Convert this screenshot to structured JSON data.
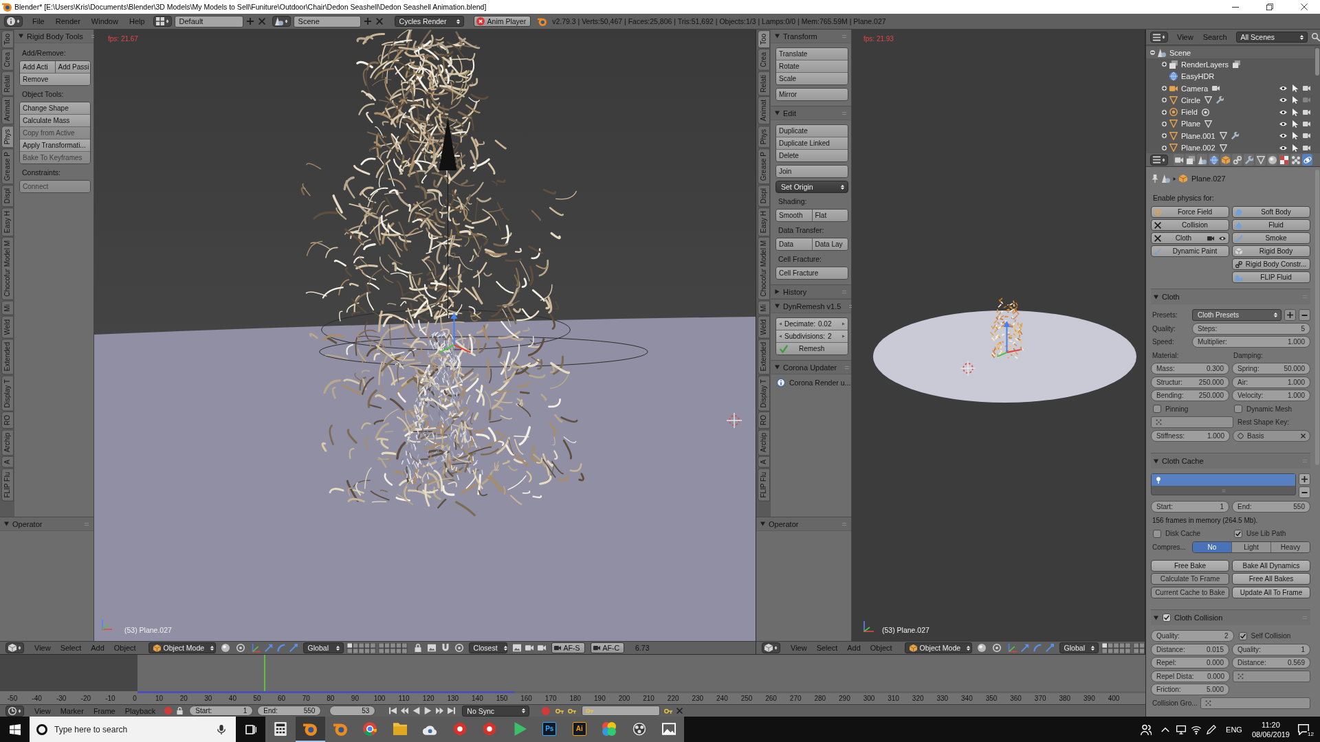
{
  "window": {
    "title": "Blender* [E:\\Users\\Kris\\Documents\\Blender\\3D Models\\My Models to Sell\\Funiture\\Outdoor\\Chair\\Dedon Seashell\\Dedon Seashell Animation.blend]"
  },
  "info_header": {
    "menus": [
      "File",
      "Render",
      "Window",
      "Help"
    ],
    "screen_layout": "Default",
    "scene": "Scene",
    "render_engine": "Cycles Render",
    "anim_player": "Anim Player",
    "stats": "v2.79.3 | Verts:50,467 | Faces:25,806 | Tris:51,692 | Objects:1/3 | Lamps:0/0 | Mem:765.59M | Plane.027"
  },
  "views": [
    {
      "tabs": [
        {
          "label": "Too",
          "selected": false
        },
        {
          "label": "Crea",
          "selected": false
        },
        {
          "label": "Relati",
          "selected": false
        },
        {
          "label": "Animat",
          "selected": false
        },
        {
          "label": "Phys",
          "selected": true
        },
        {
          "label": "Grease P",
          "selected": false
        },
        {
          "label": "Displ",
          "selected": false
        },
        {
          "label": "Easy H",
          "selected": false
        },
        {
          "label": "Chocofur Model M",
          "selected": false
        },
        {
          "label": "Mi",
          "selected": false
        },
        {
          "label": "Weld",
          "selected": false
        },
        {
          "label": "Extended",
          "selected": false
        },
        {
          "label": "Display T",
          "selected": false
        },
        {
          "label": "RO",
          "selected": false
        },
        {
          "label": "Archip",
          "selected": false
        },
        {
          "label": "A",
          "selected": false
        },
        {
          "label": "FLIP Flu",
          "selected": false
        }
      ],
      "panels": [
        {
          "title": "Rigid Body Tools",
          "expanded": true,
          "items": [
            {
              "kind": "label",
              "text": "Add/Remove:"
            },
            {
              "kind": "block",
              "rows": [
                [
                  {
                    "label": "Add Acti",
                    "disabled": false
                  },
                  {
                    "label": "Add Passi",
                    "disabled": false
                  }
                ],
                [
                  {
                    "label": "Remove",
                    "disabled": false
                  }
                ]
              ]
            },
            {
              "kind": "label",
              "text": "Object Tools:"
            },
            {
              "kind": "block",
              "rows": [
                [
                  {
                    "label": "Change Shape",
                    "disabled": false
                  }
                ],
                [
                  {
                    "label": "Calculate Mass",
                    "disabled": false
                  }
                ],
                [
                  {
                    "label": "Copy from Active",
                    "disabled": true
                  }
                ],
                [
                  {
                    "label": "Apply Transformati...",
                    "disabled": false
                  }
                ],
                [
                  {
                    "label": "Bake To Keyframes",
                    "disabled": true
                  }
                ]
              ]
            },
            {
              "kind": "label",
              "text": "Constraints:"
            },
            {
              "kind": "block",
              "rows": [
                [
                  {
                    "label": "Connect",
                    "disabled": true
                  }
                ]
              ]
            }
          ]
        }
      ],
      "operator": {
        "title": "Operator",
        "expanded": true
      },
      "viewport": {
        "kind": "closeup",
        "fps": "fps: 21.67",
        "object_label": "(53) Plane.027"
      },
      "header": {
        "menus": [
          "View",
          "Select",
          "Add",
          "Object"
        ],
        "mode": "Object Mode",
        "orientation": "Global",
        "snap_target": "Closest",
        "toggles": [
          "AF-S",
          "AF-C"
        ],
        "readout": "6.73"
      }
    },
    {
      "tabs": [
        {
          "label": "Too",
          "selected": true
        },
        {
          "label": "Crea",
          "selected": false
        },
        {
          "label": "Relati",
          "selected": false
        },
        {
          "label": "Animat",
          "selected": false
        },
        {
          "label": "Phys",
          "selected": false
        },
        {
          "label": "Grease P",
          "selected": false
        },
        {
          "label": "Displ",
          "selected": false
        },
        {
          "label": "Easy H",
          "selected": false
        },
        {
          "label": "Chocofur Model M",
          "selected": false
        },
        {
          "label": "Mi",
          "selected": false
        },
        {
          "label": "Weld",
          "selected": false
        },
        {
          "label": "Extended",
          "selected": false
        },
        {
          "label": "Display T",
          "selected": false
        },
        {
          "label": "RO",
          "selected": false
        },
        {
          "label": "Archip",
          "selected": false
        },
        {
          "label": "A",
          "selected": false
        },
        {
          "label": "FLIP Flu",
          "selected": false
        }
      ],
      "panels": [
        {
          "title": "Transform",
          "expanded": true,
          "items": [
            {
              "kind": "block",
              "rows": [
                [
                  {
                    "label": "Translate"
                  }
                ],
                [
                  {
                    "label": "Rotate"
                  }
                ],
                [
                  {
                    "label": "Scale"
                  }
                ]
              ]
            },
            {
              "kind": "block",
              "rows": [
                [
                  {
                    "label": "Mirror"
                  }
                ]
              ]
            }
          ]
        },
        {
          "title": "Edit",
          "expanded": true,
          "items": [
            {
              "kind": "block",
              "rows": [
                [
                  {
                    "label": "Duplicate"
                  }
                ],
                [
                  {
                    "label": "Duplicate Linked"
                  }
                ],
                [
                  {
                    "label": "Delete"
                  }
                ]
              ]
            },
            {
              "kind": "block",
              "rows": [
                [
                  {
                    "label": "Join"
                  }
                ]
              ]
            },
            {
              "kind": "dropdown",
              "label": "Set Origin"
            },
            {
              "kind": "label",
              "text": "Shading:"
            },
            {
              "kind": "block",
              "rows": [
                [
                  {
                    "label": "Smooth"
                  },
                  {
                    "label": "Flat"
                  }
                ]
              ]
            },
            {
              "kind": "label",
              "text": "Data Transfer:"
            },
            {
              "kind": "block",
              "rows": [
                [
                  {
                    "label": "Data"
                  },
                  {
                    "label": "Data Lay"
                  }
                ]
              ]
            },
            {
              "kind": "label",
              "text": "Cell Fracture:"
            },
            {
              "kind": "block",
              "rows": [
                [
                  {
                    "label": "Cell Fracture"
                  }
                ]
              ]
            }
          ]
        },
        {
          "title": "History",
          "expanded": false
        },
        {
          "title": "DynRemesh v1.5",
          "expanded": true,
          "items": [
            {
              "kind": "block",
              "rows": [
                [
                  {
                    "kind": "number",
                    "label": "Decimate:",
                    "value": "0.02"
                  }
                ],
                [
                  {
                    "kind": "number",
                    "label": "Subdivisions:",
                    "value": "2"
                  }
                ],
                [
                  {
                    "kind": "check_button",
                    "label": "Remesh"
                  }
                ]
              ]
            }
          ]
        },
        {
          "title": "Corona Updater",
          "expanded": true,
          "items": [
            {
              "kind": "info",
              "text": "Corona Render u..."
            }
          ]
        }
      ],
      "operator": {
        "title": "Operator",
        "expanded": true
      },
      "viewport": {
        "kind": "overview",
        "fps": "fps: 21.93",
        "object_label": "(53) Plane.027"
      },
      "header": {
        "menus": [
          "View",
          "Select",
          "Add",
          "Object"
        ],
        "mode": "Object Mode",
        "orientation": "Global"
      }
    }
  ],
  "timeline": {
    "ruler_labels": [
      "-50",
      "-40",
      "-30",
      "-20",
      "-10",
      "0",
      "10",
      "20",
      "30",
      "40",
      "50",
      "60",
      "70",
      "80",
      "90",
      "100",
      "110",
      "120",
      "130",
      "140",
      "150",
      "160",
      "170",
      "180",
      "190",
      "200",
      "210",
      "220",
      "230",
      "240",
      "250",
      "260",
      "270",
      "280",
      "290",
      "300",
      "310",
      "320",
      "330",
      "340",
      "350",
      "360",
      "370",
      "380",
      "390",
      "400"
    ],
    "cache": {
      "level": 0.374
    },
    "header": {
      "menus": [
        "View",
        "Marker",
        "Frame",
        "Playback"
      ],
      "start": {
        "label": "Start:",
        "value": "1"
      },
      "end": {
        "label": "End:",
        "value": "550"
      },
      "current_frame": "53",
      "sync": "No Sync"
    }
  },
  "outliner": {
    "menus": [
      "View",
      "Search"
    ],
    "filter": "All Scenes",
    "tree": [
      {
        "name": "Scene",
        "kind": "scene",
        "expanded": true,
        "children": [
          {
            "name": "RenderLayers",
            "kind": "render_layers",
            "expanded": false,
            "data_icons": [
              {
                "kind": "render_layers"
              }
            ]
          },
          {
            "name": "EasyHDR",
            "kind": "world"
          },
          {
            "name": "Camera",
            "kind": "camera",
            "expanded": false,
            "data_icons": [
              {
                "kind": "camera"
              }
            ],
            "visible": true,
            "selectable": true,
            "renderable": true
          },
          {
            "name": "Circle",
            "kind": "mesh",
            "expanded": false,
            "data_icons": [
              {
                "kind": "mesh"
              },
              {
                "kind": "modifier"
              }
            ],
            "visible": true,
            "selectable": true,
            "renderable": false
          },
          {
            "name": "Field",
            "kind": "empty",
            "expanded": false,
            "data_icons": [
              {
                "kind": "force"
              }
            ],
            "visible": true,
            "selectable": true,
            "renderable": true
          },
          {
            "name": "Plane",
            "kind": "mesh",
            "expanded": false,
            "data_icons": [
              {
                "kind": "mesh"
              }
            ],
            "visible": true,
            "selectable": true,
            "renderable": true
          },
          {
            "name": "Plane.001",
            "kind": "mesh",
            "expanded": false,
            "data_icons": [
              {
                "kind": "mesh"
              },
              {
                "kind": "modifier"
              }
            ],
            "visible": true,
            "selectable": true,
            "renderable": true
          },
          {
            "name": "Plane.002",
            "kind": "mesh",
            "expanded": false,
            "data_icons": [
              {
                "kind": "mesh"
              }
            ],
            "visible": true,
            "selectable": true,
            "renderable": true
          }
        ]
      }
    ]
  },
  "properties": {
    "tabs": [
      {
        "kind": "render",
        "selected": false
      },
      {
        "kind": "render_layers",
        "selected": false
      },
      {
        "kind": "scene",
        "selected": false
      },
      {
        "kind": "world",
        "selected": false
      },
      {
        "kind": "object",
        "selected": false
      },
      {
        "kind": "constraints",
        "selected": false
      },
      {
        "kind": "modifiers",
        "selected": false
      },
      {
        "kind": "data",
        "selected": false
      },
      {
        "kind": "material",
        "selected": false
      },
      {
        "kind": "texture",
        "selected": false
      },
      {
        "kind": "particles",
        "selected": false
      },
      {
        "kind": "physics",
        "selected": true
      }
    ],
    "object_name": "Plane.027",
    "enable_label": "Enable physics for:",
    "physics_left": [
      {
        "kind": "force_field",
        "label": "Force Field",
        "enabled": false,
        "toggles": false
      },
      {
        "kind": "collision",
        "label": "Collision",
        "enabled": true,
        "toggles": false
      },
      {
        "kind": "cloth",
        "label": "Cloth",
        "enabled": true,
        "toggles": true
      },
      {
        "kind": "dynamic_paint",
        "label": "Dynamic Paint",
        "enabled": false,
        "toggles": false
      }
    ],
    "physics_right": [
      {
        "kind": "soft_body",
        "label": "Soft Body",
        "enabled": false,
        "toggles": false
      },
      {
        "kind": "fluid",
        "label": "Fluid",
        "enabled": false,
        "toggles": false
      },
      {
        "kind": "smoke",
        "label": "Smoke",
        "enabled": false,
        "toggles": false
      },
      {
        "kind": "rigid_body",
        "label": "Rigid Body",
        "enabled": false,
        "toggles": false
      },
      {
        "kind": "rigid_body_constraint",
        "label": "Rigid Body Constr...",
        "enabled": false,
        "toggles": false
      },
      {
        "kind": "flip_fluid",
        "label": "FLIP Fluid",
        "enabled": false,
        "toggles": false
      }
    ],
    "panels": [
      {
        "title": "Cloth",
        "expanded": true,
        "rows": [
          [
            {
              "kind": "prefix",
              "text": "Presets:",
              "disabled": true
            },
            {
              "kind": "menu",
              "text": "Cloth Presets",
              "disabled": true
            },
            {
              "kind": "addremove",
              "disabled": true
            }
          ],
          [
            {
              "kind": "prefix",
              "text": "Quality:",
              "disabled": true
            },
            {
              "kind": "number",
              "label": "Steps:",
              "value": "5",
              "disabled": true
            }
          ],
          [
            {
              "kind": "prefix",
              "text": "Speed:",
              "disabled": true
            },
            {
              "kind": "number",
              "label": "Multiplier:",
              "value": "1.000",
              "disabled": true
            }
          ],
          [
            {
              "kind": "text",
              "text": "Material:",
              "disabled": true
            },
            {
              "kind": "text",
              "text": "Damping:",
              "disabled": true
            }
          ],
          [
            {
              "kind": "number",
              "label": "Mass:",
              "value": "0.300",
              "disabled": true
            },
            {
              "kind": "number",
              "label": "Spring:",
              "value": "50.000",
              "disabled": true
            }
          ],
          [
            {
              "kind": "number",
              "label": "Structur:",
              "value": "250.000",
              "disabled": true
            },
            {
              "kind": "number",
              "label": "Air:",
              "value": "1.000",
              "disabled": true
            }
          ],
          [
            {
              "kind": "number",
              "label": "Bending:",
              "value": "250.000",
              "disabled": true
            },
            {
              "kind": "number",
              "label": "Velocity:",
              "value": "1.000",
              "disabled": true
            }
          ],
          [
            {
              "kind": "check",
              "label": "Pinning",
              "checked": false,
              "disabled": true
            },
            {
              "kind": "check",
              "label": "Dynamic Mesh",
              "checked": false,
              "disabled": true
            }
          ],
          [
            {
              "kind": "group_field",
              "disabled": true
            },
            {
              "kind": "text",
              "text": "Rest Shape Key:",
              "disabled": true
            }
          ],
          [
            {
              "kind": "number",
              "label": "Stiffness:",
              "value": "1.000",
              "disabled": true
            },
            {
              "kind": "shape_key",
              "text": "Basis",
              "disabled": true
            }
          ]
        ]
      },
      {
        "title": "Cloth Cache",
        "expanded": true,
        "rows": [
          [
            {
              "kind": "list",
              "items": [
                {
                  "selected": true
                }
              ]
            }
          ],
          [
            {
              "kind": "number",
              "label": "Start:",
              "value": "1",
              "disabled": true
            },
            {
              "kind": "number",
              "label": "End:",
              "value": "550",
              "disabled": true
            }
          ],
          [
            {
              "kind": "text",
              "text": "156 frames in memory (264.5 Mb).",
              "disabled": false
            }
          ],
          [
            {
              "kind": "check",
              "label": "Disk Cache",
              "checked": false,
              "disabled": true
            },
            {
              "kind": "check",
              "label": "Use Lib Path",
              "checked": true,
              "disabled": true
            }
          ],
          [
            {
              "kind": "prefix",
              "text": "Compres...",
              "disabled": true
            },
            {
              "kind": "segmented",
              "disabled": true,
              "options": [
                {
                  "label": "No",
                  "selected": true
                },
                {
                  "label": "Light",
                  "selected": false
                },
                {
                  "label": "Heavy",
                  "selected": false
                }
              ]
            }
          ],
          [
            {
              "kind": "button",
              "label": "Free Bake",
              "disabled": false
            },
            {
              "kind": "button",
              "label": "Bake All Dynamics",
              "disabled": false
            }
          ],
          [
            {
              "kind": "button",
              "label": "Calculate To Frame",
              "disabled": true
            },
            {
              "kind": "button",
              "label": "Free All Bakes",
              "disabled": false
            }
          ],
          [
            {
              "kind": "button",
              "label": "Current Cache to Bake",
              "disabled": true
            },
            {
              "kind": "button",
              "label": "Update All To Frame",
              "disabled": false
            }
          ]
        ]
      },
      {
        "title": "Cloth Collision",
        "expanded": true,
        "checkbox": true,
        "rows": [
          [
            {
              "kind": "number",
              "label": "Quality:",
              "value": "2",
              "disabled": true
            },
            {
              "kind": "check",
              "label": "Self Collision",
              "checked": true,
              "disabled": true
            }
          ],
          [
            {
              "kind": "number",
              "label": "Distance:",
              "value": "0.015",
              "disabled": true
            },
            {
              "kind": "number",
              "label": "Quality:",
              "value": "1",
              "disabled": true
            }
          ],
          [
            {
              "kind": "number",
              "label": "Repel:",
              "value": "0.000",
              "disabled": true
            },
            {
              "kind": "number",
              "label": "Distance:",
              "value": "0.569",
              "disabled": true
            }
          ],
          [
            {
              "kind": "number",
              "label": "Repel Dista:",
              "value": "0.000",
              "disabled": true
            },
            {
              "kind": "group_field",
              "disabled": true
            }
          ],
          [
            {
              "kind": "number",
              "label": "Friction:",
              "value": "5.000",
              "disabled": true
            }
          ],
          [
            {
              "kind": "prefix",
              "text": "Collision Gro...",
              "disabled": true
            },
            {
              "kind": "group_field",
              "disabled": true
            }
          ]
        ]
      }
    ]
  },
  "taskbar": {
    "search": {
      "placeholder": "Type here to search"
    },
    "apps": [
      {
        "kind": "calculator",
        "active": false
      },
      {
        "kind": "logo",
        "active": true
      },
      {
        "kind": "logo",
        "active": false
      },
      {
        "kind": "browser",
        "active": false
      },
      {
        "kind": "folder",
        "active": false
      },
      {
        "kind": "cloud",
        "active": false
      },
      {
        "kind": "hexagon",
        "active": false
      },
      {
        "kind": "hexagon",
        "active": false
      },
      {
        "kind": "play",
        "active": false
      },
      {
        "kind": "tile",
        "label": "Ps",
        "color": "#31a8ff",
        "active": false
      },
      {
        "kind": "tile",
        "label": "Ai",
        "color": "#ff9a00",
        "active": false
      },
      {
        "kind": "flower",
        "active": false
      },
      {
        "kind": "aperture",
        "active": false
      },
      {
        "kind": "picture",
        "active": false
      }
    ],
    "tray": {
      "language": "ENG",
      "time": "11:20",
      "date": "08/06/2019",
      "notifications": "12"
    }
  }
}
